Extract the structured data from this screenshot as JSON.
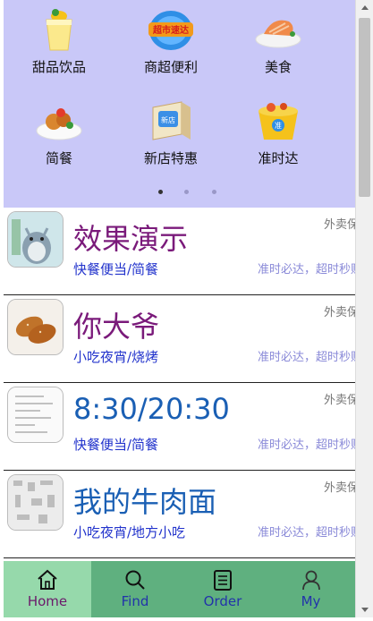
{
  "categories": [
    {
      "label": "甜品饮品",
      "icon": "dessert-drink-icon"
    },
    {
      "label": "商超便利",
      "icon": "supermarket-icon",
      "badge": "超市速达"
    },
    {
      "label": "美食",
      "icon": "food-icon"
    },
    {
      "label": "简餐",
      "icon": "simple-meal-icon"
    },
    {
      "label": "新店特惠",
      "icon": "new-store-icon",
      "badge": "新店"
    },
    {
      "label": "准时达",
      "icon": "on-time-icon",
      "badge": "准"
    }
  ],
  "carousel": {
    "pages": 3,
    "active_page": 1
  },
  "shops": [
    {
      "name": "效果演示",
      "category": "快餐便当/简餐",
      "tag": "外卖保",
      "promo": "准时必达，超时秒赔",
      "name_color": "#7a1a7a"
    },
    {
      "name": "你大爷",
      "category": "小吃夜宵/烧烤",
      "tag": "外卖保",
      "promo": "准时必达，超时秒赔",
      "name_color": "#7a1a7a"
    },
    {
      "name": "8:30/20:30",
      "category": "快餐便当/简餐",
      "tag": "外卖保",
      "promo": "准时必达，超时秒赔",
      "name_color": "#1a5fb4"
    },
    {
      "name": "我的牛肉面",
      "category": "小吃夜宵/地方小吃",
      "tag": "外卖保",
      "promo": "准时必达，超时秒赔",
      "name_color": "#1a5fb4"
    }
  ],
  "tabs": [
    {
      "label": "Home",
      "icon": "home-icon",
      "active": true
    },
    {
      "label": "Find",
      "icon": "search-icon",
      "active": false
    },
    {
      "label": "Order",
      "icon": "order-list-icon",
      "active": false
    },
    {
      "label": "My",
      "icon": "user-icon",
      "active": false
    }
  ],
  "colors": {
    "panel": "#c9c8f8",
    "tabbar": "#5fb07f",
    "tab_active": "#96d9ab"
  }
}
